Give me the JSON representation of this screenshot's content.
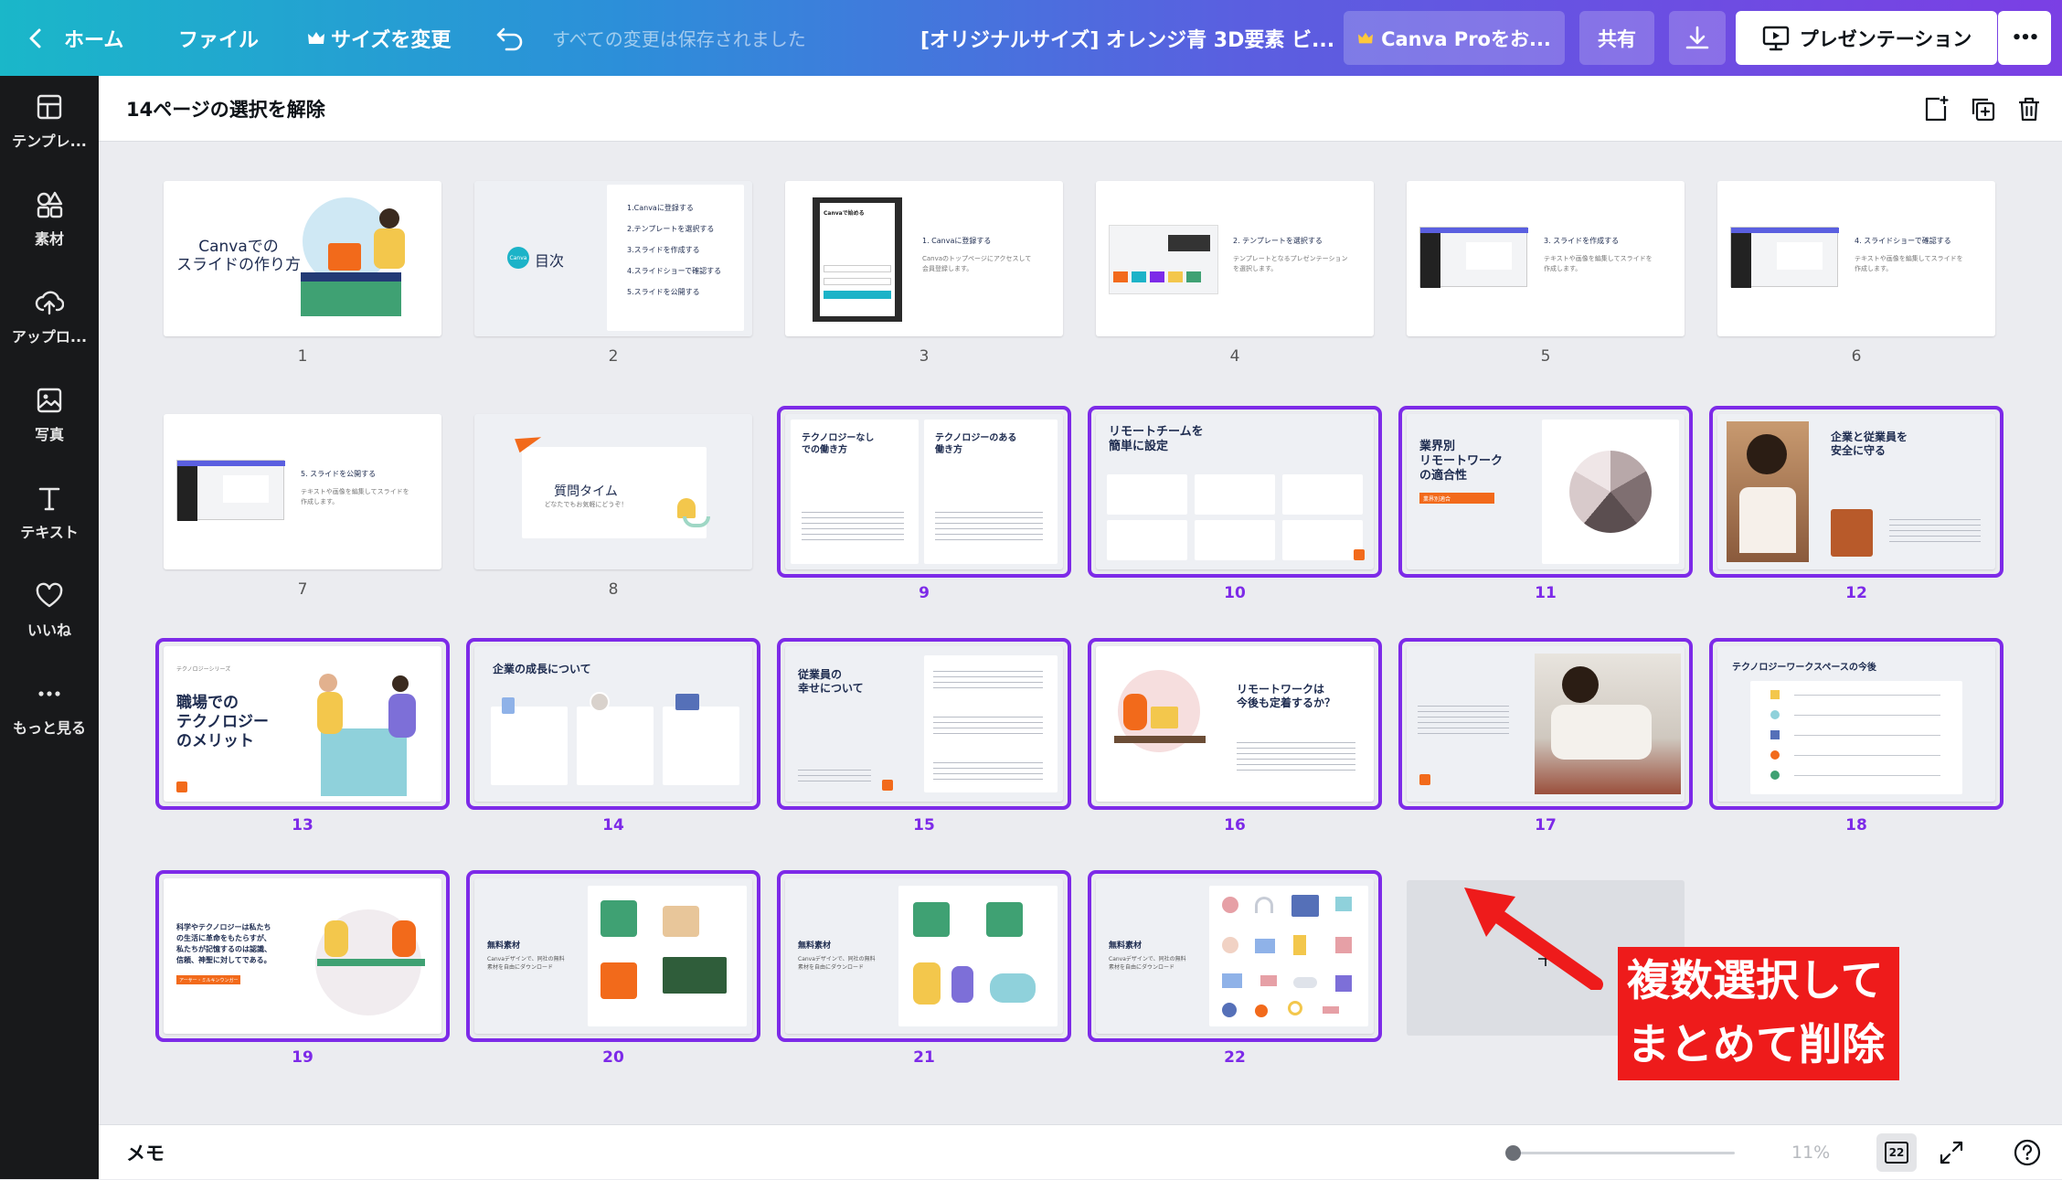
{
  "header": {
    "home": "ホーム",
    "file": "ファイル",
    "resize": "サイズを変更",
    "save_status": "すべての変更は保存されました",
    "doc_title": "[オリジナルサイズ] オレンジ青 3D要素 ビ...",
    "canva_pro": "Canva Proをお...",
    "share": "共有",
    "present": "プレゼンテーション",
    "more": "•••"
  },
  "sidebar": {
    "items": [
      {
        "label": "テンプレ...",
        "icon": "template-icon"
      },
      {
        "label": "素材",
        "icon": "elements-icon"
      },
      {
        "label": "アップロ...",
        "icon": "upload-icon"
      },
      {
        "label": "写真",
        "icon": "photo-icon"
      },
      {
        "label": "テキスト",
        "icon": "text-icon"
      },
      {
        "label": "いいね",
        "icon": "heart-icon"
      },
      {
        "label": "もっと見る",
        "icon": "more-icon"
      }
    ]
  },
  "toolbar": {
    "deselect": "14ページの選択を解除"
  },
  "pages": {
    "p1": {
      "num": "1",
      "title": "Canvaでの\nスライドの作り方"
    },
    "p2": {
      "num": "2",
      "logo": "Canva",
      "title": "目次",
      "items": [
        "1.Canvaに登録する",
        "2.テンプレートを選択する",
        "3.スライドを作成する",
        "4.スライドショーで確認する",
        "5.スライドを公開する"
      ]
    },
    "p3": {
      "num": "3",
      "heading": "1. Canvaに登録する",
      "body": "Canvaのトップページにアクセスして\n会員登録します。",
      "login": "Canvaで始める"
    },
    "p4": {
      "num": "4",
      "heading": "2. テンプレートを選択する",
      "body": "テンプレートとなるプレゼンテーション\nを選択します。"
    },
    "p5": {
      "num": "5",
      "heading": "3. スライドを作成する",
      "body": "テキストや画像を編集してスライドを\n作成します。"
    },
    "p6": {
      "num": "6",
      "heading": "4. スライドショーで確認する",
      "body": "テキストや画像を編集してスライドを\n作成します。"
    },
    "p7": {
      "num": "7",
      "heading": "5. スライドを公開する",
      "body": "テキストや画像を編集してスライドを\n作成します。"
    },
    "p8": {
      "num": "8",
      "title": "質問タイム",
      "sub": "どなたでもお気軽にどうぞ！"
    },
    "p9": {
      "num": "9",
      "col1": "テクノロジーなし\nでの働き方",
      "col2": "テクノロジーのある\n働き方"
    },
    "p10": {
      "num": "10",
      "title": "リモートチームを\n簡単に設定"
    },
    "p11": {
      "num": "11",
      "title": "業界別\nリモートワーク\nの適合性",
      "tag": "業界別適合"
    },
    "p12": {
      "num": "12",
      "title": "企業と従業員を\n安全に守る"
    },
    "p13": {
      "num": "13",
      "kicker": "テクノロジーシリーズ",
      "title": "職場での\nテクノロジー\nのメリット"
    },
    "p14": {
      "num": "14",
      "title": "企業の成長について"
    },
    "p15": {
      "num": "15",
      "title": "従業員の\n幸せについて"
    },
    "p16": {
      "num": "16",
      "title": "リモートワークは\n今後も定着するか？"
    },
    "p17": {
      "num": "17"
    },
    "p18": {
      "num": "18",
      "title": "テクノロジーワークスペースの今後"
    },
    "p19": {
      "num": "19",
      "title": "科学やテクノロジーは私たち\nの生活に革命をもたらすが、\n私たちが記憶するのは認識、\n信頼、神聖に対してである。",
      "tag": "アーサー・ミルキンウンガー"
    },
    "p20": {
      "num": "20",
      "title": "無料素材",
      "body": "Canvaデザインで、同社の無料\n素材を自由にダウンロード"
    },
    "p21": {
      "num": "21",
      "title": "無料素材",
      "body": "Canvaデザインで、同社の無料\n素材を自由にダウンロード"
    },
    "p22": {
      "num": "22",
      "title": "無料素材",
      "body": "Canvaデザインで、同社の無料\n素材を自由にダウンロード"
    }
  },
  "annotation": {
    "text": "複数選択して\nまとめて削除"
  },
  "bottombar": {
    "memo": "メモ",
    "zoom": "11%",
    "page_count": "22",
    "zoom_level": 0.03
  },
  "colors": {
    "selection": "#7d2ae8",
    "accent_orange": "#f26a1b",
    "navy": "#1d2b4f",
    "annotation_red": "#ee1b1b"
  }
}
